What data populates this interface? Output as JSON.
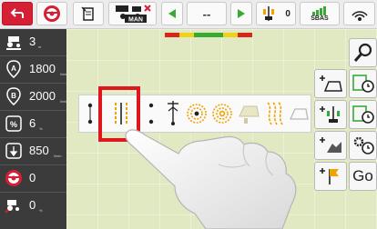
{
  "topbar": {
    "gps_mode_label": "MAN",
    "nav_value": "--",
    "section_counter": "0",
    "gps_source_label": "SBAS"
  },
  "sidebar": {
    "rows": [
      {
        "icon": "tractor-implement-icon",
        "value": "3",
        "unit": "m"
      },
      {
        "icon": "a-point-icon",
        "value": "1800",
        "unit": "l/min"
      },
      {
        "icon": "b-point-icon",
        "value": "2000",
        "unit": "l/min"
      },
      {
        "icon": "percent-icon",
        "value": "6",
        "unit": "%"
      },
      {
        "icon": "nozzle-icon",
        "value": "850",
        "unit": "l/min"
      },
      {
        "icon": "steering-wheel-icon",
        "value": "0",
        "unit": ""
      },
      {
        "icon": "tractor-speed-icon",
        "value": "0",
        "unit": "%"
      }
    ]
  },
  "guidance_patterns": [
    {
      "name": "ab-straight-pattern",
      "selected": false
    },
    {
      "name": "parallel-lines-pattern",
      "selected": true
    },
    {
      "name": "ab-contour-pattern",
      "selected": false
    },
    {
      "name": "a-plus-pattern",
      "selected": false
    },
    {
      "name": "circle-pattern",
      "selected": false
    },
    {
      "name": "spiral-pattern",
      "selected": false
    },
    {
      "name": "field-boundary-pattern",
      "selected": false
    },
    {
      "name": "curved-lines-pattern",
      "selected": false
    },
    {
      "name": "headland-pattern",
      "selected": false
    }
  ],
  "right_panel": {
    "go_label": "Go"
  },
  "colors": {
    "accent_red": "#d51f35",
    "sidebar_bg": "#3b3b3b",
    "field_bg": "#e1e9c2",
    "selection_red": "#e0161f",
    "statusbar": [
      "#d9261c",
      "#f0d21a",
      "#39a935",
      "#39a935",
      "#f0d21a",
      "#d9261c"
    ]
  }
}
